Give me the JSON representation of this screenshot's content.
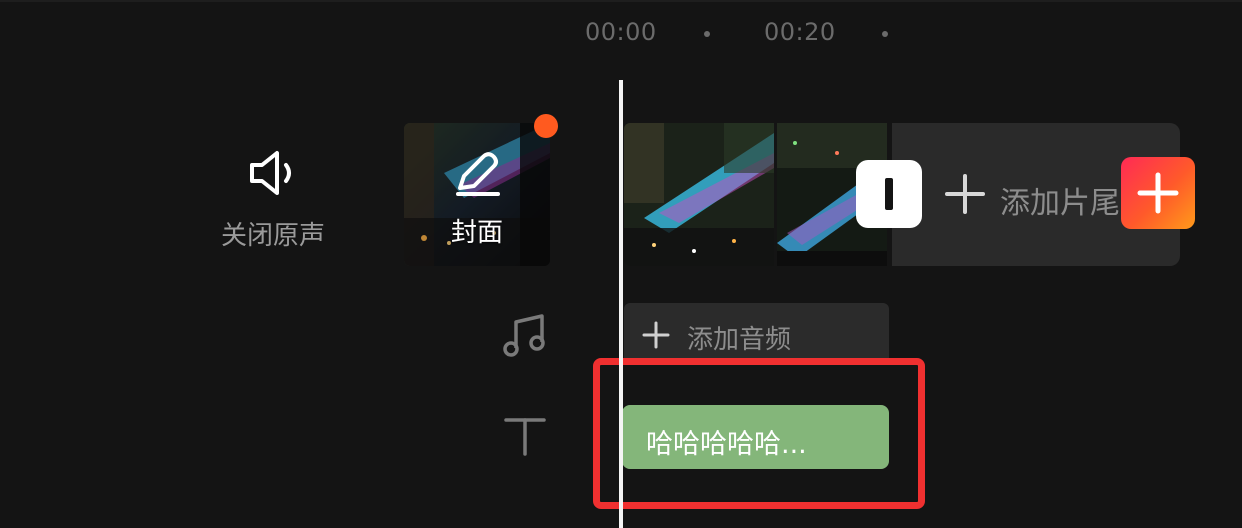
{
  "ruler": {
    "times": [
      "00:00",
      "00:20"
    ]
  },
  "track_header": {
    "mute_label": "关闭原声"
  },
  "cover": {
    "label": "封面"
  },
  "video_track": {
    "end_label": "添加片尾"
  },
  "audio_track": {
    "add_label": "添加音频"
  },
  "text_track": {
    "clip_text": "哈哈哈哈哈..."
  },
  "colors": {
    "background": "#141414",
    "text_clip": "#84b67a",
    "highlight": "#f03030",
    "cover_dot": "#ff5a1f",
    "add_button_gradient": [
      "#ff2a55",
      "#ff9a1a"
    ]
  },
  "icons": {
    "mute": "speaker-outline-icon",
    "cover_edit": "pencil-icon",
    "end_add": "plus-icon",
    "add_clip": "plus-icon",
    "audio": "music-note-icon",
    "text": "text-t-icon"
  }
}
